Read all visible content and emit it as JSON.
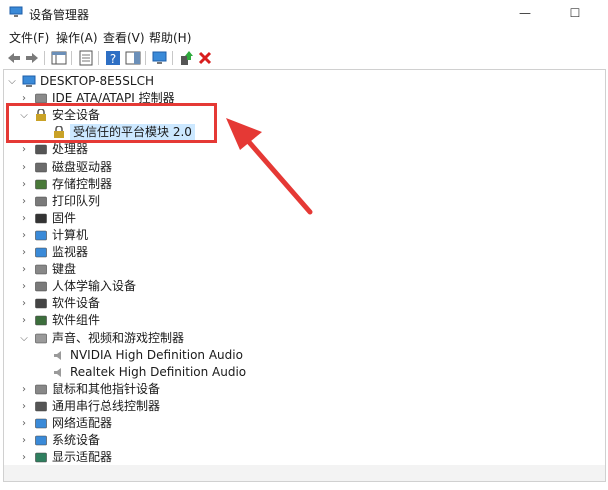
{
  "window": {
    "title": "设备管理器",
    "controls": {
      "minimize": "—",
      "maximize": "☐"
    }
  },
  "menu": [
    {
      "label": "文件(F)"
    },
    {
      "label": "操作(A)"
    },
    {
      "label": "查看(V)"
    },
    {
      "label": "帮助(H)"
    }
  ],
  "toolbar": {
    "back": "back-arrow-icon",
    "forward": "forward-arrow-icon",
    "remove": "red-x-icon"
  },
  "tree": {
    "root": "DESKTOP-8E5SLCH",
    "items": [
      {
        "label": "IDE ATA/ATAPI 控制器",
        "expanded": false,
        "icon": "ide-controller-icon",
        "depth": 1
      },
      {
        "label": "安全设备",
        "expanded": true,
        "icon": "security-device-icon",
        "depth": 1
      },
      {
        "label": "受信任的平台模块 2.0",
        "expanded": null,
        "icon": "tpm-icon",
        "depth": 2,
        "selected": true
      },
      {
        "label": "处理器",
        "expanded": false,
        "icon": "processor-icon",
        "depth": 1
      },
      {
        "label": "磁盘驱动器",
        "expanded": false,
        "icon": "disk-drive-icon",
        "depth": 1
      },
      {
        "label": "存储控制器",
        "expanded": false,
        "icon": "storage-controller-icon",
        "depth": 1
      },
      {
        "label": "打印队列",
        "expanded": false,
        "icon": "printer-icon",
        "depth": 1
      },
      {
        "label": "固件",
        "expanded": false,
        "icon": "firmware-icon",
        "depth": 1
      },
      {
        "label": "计算机",
        "expanded": false,
        "icon": "computer-icon",
        "depth": 1
      },
      {
        "label": "监视器",
        "expanded": false,
        "icon": "monitor-icon",
        "depth": 1
      },
      {
        "label": "键盘",
        "expanded": false,
        "icon": "keyboard-icon",
        "depth": 1
      },
      {
        "label": "人体学输入设备",
        "expanded": false,
        "icon": "hid-icon",
        "depth": 1
      },
      {
        "label": "软件设备",
        "expanded": false,
        "icon": "software-device-icon",
        "depth": 1
      },
      {
        "label": "软件组件",
        "expanded": false,
        "icon": "software-component-icon",
        "depth": 1
      },
      {
        "label": "声音、视频和游戏控制器",
        "expanded": true,
        "icon": "sound-icon",
        "depth": 1
      },
      {
        "label": "NVIDIA High Definition Audio",
        "expanded": null,
        "icon": "speaker-icon",
        "depth": 2
      },
      {
        "label": "Realtek High Definition Audio",
        "expanded": null,
        "icon": "speaker-icon",
        "depth": 2
      },
      {
        "label": "鼠标和其他指针设备",
        "expanded": false,
        "icon": "mouse-icon",
        "depth": 1
      },
      {
        "label": "通用串行总线控制器",
        "expanded": false,
        "icon": "usb-icon",
        "depth": 1
      },
      {
        "label": "网络适配器",
        "expanded": false,
        "icon": "network-adapter-icon",
        "depth": 1
      },
      {
        "label": "系统设备",
        "expanded": false,
        "icon": "system-device-icon",
        "depth": 1
      },
      {
        "label": "显示适配器",
        "expanded": false,
        "icon": "display-adapter-icon",
        "depth": 1
      }
    ]
  },
  "colors": {
    "annotation": "#e53935",
    "selection": "#cce8ff"
  }
}
